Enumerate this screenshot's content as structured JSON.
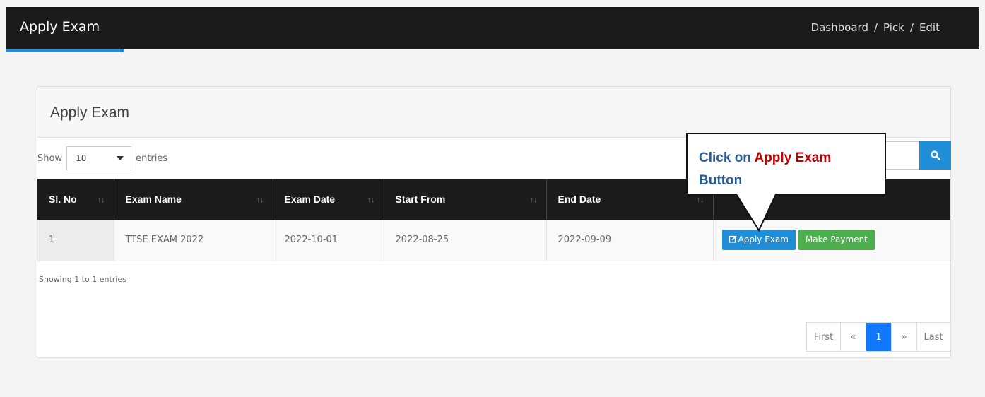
{
  "header": {
    "title": "Apply Exam",
    "breadcrumb": [
      "Dashboard",
      "Pick",
      "Edit"
    ],
    "breadcrumb_separator": "/",
    "accent_color": "#1f8ed6"
  },
  "panel": {
    "title": "Apply Exam",
    "show_label": "Show",
    "entries_label": "entries",
    "page_size": "10",
    "search_icon": "search-icon"
  },
  "table": {
    "columns": [
      "Sl. No",
      "Exam Name",
      "Exam Date",
      "Start From",
      "End Date"
    ],
    "sort_glyph": "↑↓",
    "rows": [
      {
        "sl": "1",
        "exam_name": "TTSE EXAM 2022",
        "exam_date": "2022-10-01",
        "start_from": "2022-08-25",
        "end_date": "2022-09-09",
        "apply_label": "Apply Exam",
        "payment_label": "Make Payment"
      }
    ]
  },
  "footer": {
    "showing": "Showing 1 to 1  entries",
    "pager": {
      "first": "First",
      "prev": "«",
      "current": "1",
      "next": "»",
      "last": "Last"
    }
  },
  "callout": {
    "prefix": "Click on ",
    "highlight": "Apply Exam",
    "suffix": "Button"
  }
}
